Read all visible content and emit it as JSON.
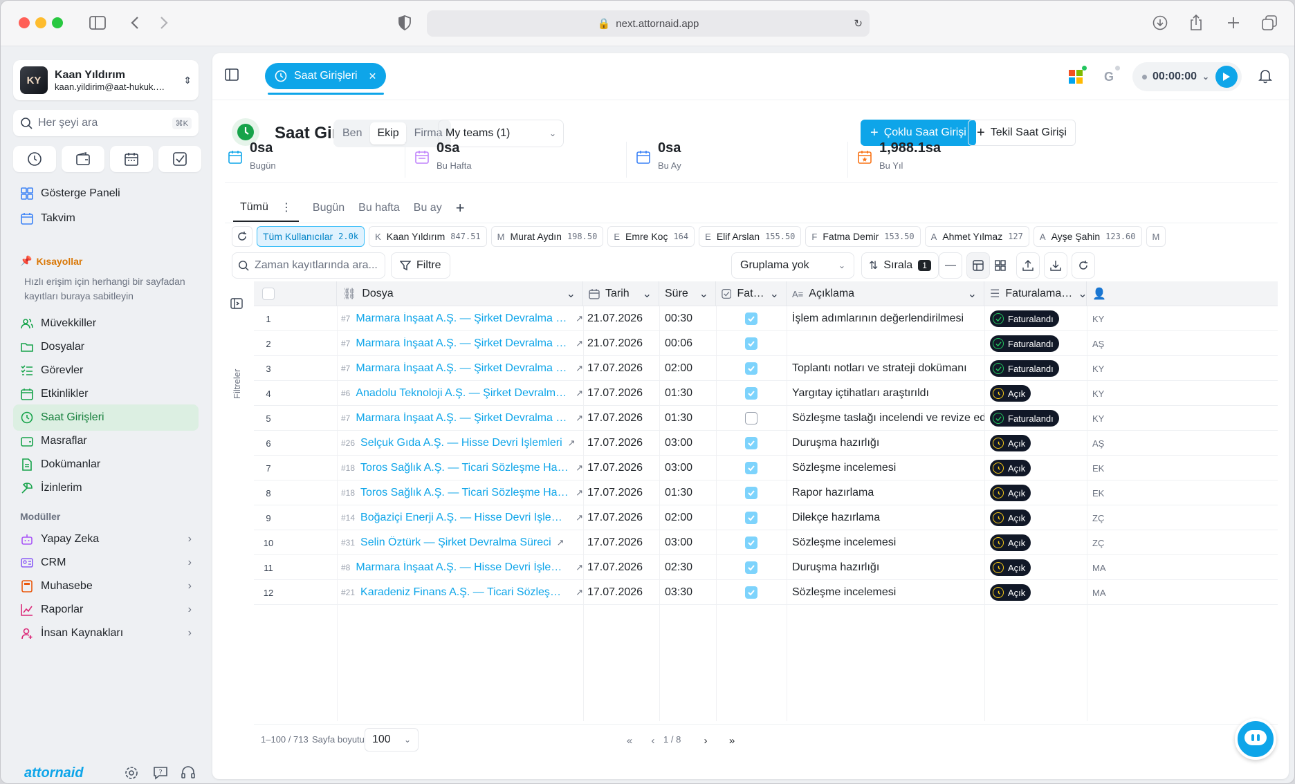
{
  "browser": {
    "url": "next.attornaid.app"
  },
  "user": {
    "name": "Kaan Yıldırım",
    "email": "kaan.yildirim@aat-hukuk.…",
    "initials": "KY"
  },
  "search": {
    "placeholder": "Her şeyi ara",
    "shortcut": "⌘K"
  },
  "nav_top": [
    {
      "label": "Gösterge Paneli",
      "icon": "dashboard-icon"
    },
    {
      "label": "Takvim",
      "icon": "calendar-icon"
    }
  ],
  "shortcuts": {
    "title": "Kısayollar",
    "hint": "Hızlı erişim için herhangi bir sayfadan kayıtları buraya sabitleyin"
  },
  "nav_main": [
    {
      "label": "Müvekkiller",
      "icon": "users-icon"
    },
    {
      "label": "Dosyalar",
      "icon": "folder-icon"
    },
    {
      "label": "Görevler",
      "icon": "tasks-icon"
    },
    {
      "label": "Etkinlikler",
      "icon": "events-icon"
    },
    {
      "label": "Saat Girişleri",
      "icon": "clock-icon",
      "active": true
    },
    {
      "label": "Masraflar",
      "icon": "wallet-icon"
    },
    {
      "label": "Dokümanlar",
      "icon": "document-icon"
    },
    {
      "label": "İzinlerim",
      "icon": "leave-icon"
    }
  ],
  "modules": {
    "title": "Modüller",
    "items": [
      {
        "label": "Yapay Zeka",
        "icon": "robot-icon"
      },
      {
        "label": "CRM",
        "icon": "crm-icon"
      },
      {
        "label": "Muhasebe",
        "icon": "calculator-icon"
      },
      {
        "label": "Raporlar",
        "icon": "chart-icon"
      },
      {
        "label": "İnsan Kaynakları",
        "icon": "person-icon"
      }
    ]
  },
  "brand": {
    "logo": "attornaid"
  },
  "topbar": {
    "tab_label": "Saat Girişleri",
    "timer": "00:00:00"
  },
  "page": {
    "title": "Saat Girişleri",
    "scope": [
      "Ben",
      "Ekip",
      "Firma"
    ],
    "scope_active": "Ekip",
    "teams": "My teams (1)",
    "btn_multi": "Çoklu Saat Girişi",
    "btn_single": "Tekil Saat Girişi"
  },
  "stats": [
    {
      "value": "0sa",
      "label": "Bugün",
      "color": "#0ea5e9"
    },
    {
      "value": "0sa",
      "label": "Bu Hafta",
      "color": "#c084fc"
    },
    {
      "value": "0sa",
      "label": "Bu Ay",
      "color": "#3b82f6"
    },
    {
      "value": "1,988.1sa",
      "label": "Bu Yıl",
      "color": "#f97316"
    }
  ],
  "view_tabs": [
    "Tümü",
    "Bugün",
    "Bu hafta",
    "Bu ay"
  ],
  "chips": [
    {
      "ini": "",
      "name": "Tüm Kullanıcılar",
      "count": "2.0k",
      "active": true
    },
    {
      "ini": "K",
      "name": "Kaan Yıldırım",
      "count": "847.51"
    },
    {
      "ini": "M",
      "name": "Murat Aydın",
      "count": "198.50"
    },
    {
      "ini": "E",
      "name": "Emre Koç",
      "count": "164"
    },
    {
      "ini": "E",
      "name": "Elif Arslan",
      "count": "155.50"
    },
    {
      "ini": "F",
      "name": "Fatma Demir",
      "count": "153.50"
    },
    {
      "ini": "A",
      "name": "Ahmet Yılmaz",
      "count": "127"
    },
    {
      "ini": "A",
      "name": "Ayşe Şahin",
      "count": "123.60"
    },
    {
      "ini": "M",
      "name": "",
      "count": ""
    }
  ],
  "toolbar": {
    "search_placeholder": "Zaman kayıtlarında ara...",
    "filter": "Filtre",
    "group": "Gruplama yok",
    "sort": "Sırala",
    "sort_count": "1"
  },
  "filters_label": "Filtreler",
  "columns": {
    "file": "Dosya",
    "date": "Tarih",
    "duration": "Süre",
    "billable": "Fat…",
    "desc": "Açıklama",
    "billing": "Faturalama…"
  },
  "rows": [
    {
      "n": "1",
      "id": "#7",
      "file": "Marmara İnşaat A.Ş. — Şirket Devralma Süreci",
      "date": "21.07.2026",
      "dur": "00:30",
      "chk": true,
      "desc": "İşlem adımlarının değerlendirilmesi",
      "status": "Faturalandı",
      "ini": "KY"
    },
    {
      "n": "2",
      "id": "#7",
      "file": "Marmara İnşaat A.Ş. — Şirket Devralma Süreci",
      "date": "21.07.2026",
      "dur": "00:06",
      "chk": true,
      "desc": "",
      "status": "Faturalandı",
      "ini": "AŞ"
    },
    {
      "n": "3",
      "id": "#7",
      "file": "Marmara İnşaat A.Ş. — Şirket Devralma Süreci",
      "date": "17.07.2026",
      "dur": "02:00",
      "chk": true,
      "desc": "Toplantı notları ve strateji dokümanı",
      "status": "Faturalandı",
      "ini": "KY"
    },
    {
      "n": "4",
      "id": "#6",
      "file": "Anadolu Teknoloji A.Ş. — Şirket Devralma Sü…",
      "date": "17.07.2026",
      "dur": "01:30",
      "chk": true,
      "desc": "Yargıtay içtihatları araştırıldı",
      "status": "Açık",
      "ini": "KY"
    },
    {
      "n": "5",
      "id": "#7",
      "file": "Marmara İnşaat A.Ş. — Şirket Devralma Süreci",
      "date": "17.07.2026",
      "dur": "01:30",
      "chk": false,
      "desc": "Sözleşme taslağı incelendi ve revize edildi",
      "status": "Faturalandı",
      "ini": "KY"
    },
    {
      "n": "6",
      "id": "#26",
      "file": "Selçuk Gıda A.Ş. — Hisse Devri İşlemleri",
      "date": "17.07.2026",
      "dur": "03:00",
      "chk": true,
      "desc": "Duruşma hazırlığı",
      "status": "Açık",
      "ini": "AŞ"
    },
    {
      "n": "7",
      "id": "#18",
      "file": "Toros Sağlık A.Ş. — Ticari Sözleşme Hazırlama",
      "date": "17.07.2026",
      "dur": "03:00",
      "chk": true,
      "desc": "Sözleşme incelemesi",
      "status": "Açık",
      "ini": "EK"
    },
    {
      "n": "8",
      "id": "#18",
      "file": "Toros Sağlık A.Ş. — Ticari Sözleşme Hazırlama",
      "date": "17.07.2026",
      "dur": "01:30",
      "chk": true,
      "desc": "Rapor hazırlama",
      "status": "Açık",
      "ini": "EK"
    },
    {
      "n": "9",
      "id": "#14",
      "file": "Boğaziçi Enerji A.Ş. — Hisse Devri İşlemleri",
      "date": "17.07.2026",
      "dur": "02:00",
      "chk": true,
      "desc": "Dilekçe hazırlama",
      "status": "Açık",
      "ini": "ZÇ"
    },
    {
      "n": "10",
      "id": "#31",
      "file": "Selin Öztürk — Şirket Devralma Süreci",
      "date": "17.07.2026",
      "dur": "03:00",
      "chk": true,
      "desc": "Sözleşme incelemesi",
      "status": "Açık",
      "ini": "ZÇ"
    },
    {
      "n": "11",
      "id": "#8",
      "file": "Marmara İnşaat A.Ş. — Hisse Devri İşlemleri",
      "date": "17.07.2026",
      "dur": "02:30",
      "chk": true,
      "desc": "Duruşma hazırlığı",
      "status": "Açık",
      "ini": "MA"
    },
    {
      "n": "12",
      "id": "#21",
      "file": "Karadeniz Finans A.Ş. — Ticari Sözleşme Ha…",
      "date": "17.07.2026",
      "dur": "03:30",
      "chk": true,
      "desc": "Sözleşme incelemesi",
      "status": "Açık",
      "ini": "MA"
    }
  ],
  "footer": {
    "range": "1–100 / 713",
    "page_size_label": "Sayfa boyutu",
    "page_size": "100",
    "page": "1 / 8"
  }
}
